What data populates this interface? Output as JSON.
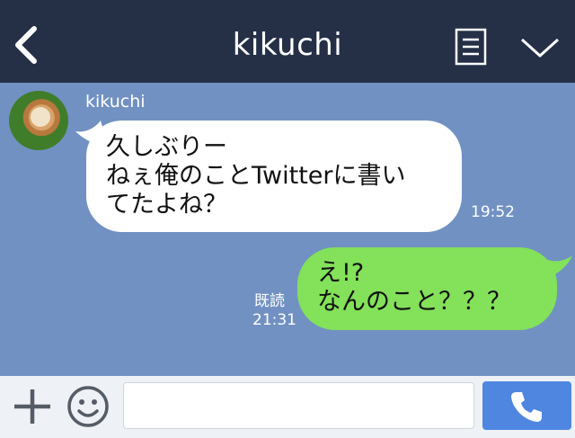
{
  "header": {
    "title": "kikuchi",
    "back_icon": "chevron-left-icon",
    "note_icon": "note-icon",
    "menu_icon": "chevron-down-icon"
  },
  "messages": [
    {
      "direction": "incoming",
      "sender": "kikuchi",
      "lines": [
        "久しぶりー",
        "ねぇ俺のことTwitterに書い",
        "てたよね？"
      ],
      "time": "19:52"
    },
    {
      "direction": "outgoing",
      "lines": [
        "え!?",
        "なんのこと？？？"
      ],
      "read_label": "既読",
      "time": "21:31"
    }
  ],
  "footer": {
    "input_value": "",
    "plus_icon": "plus-icon",
    "emoji_icon": "smiley-icon",
    "call_icon": "phone-icon"
  },
  "colors": {
    "header_bg": "#253047",
    "chat_bg": "#7191c2",
    "incoming_bubble": "#ffffff",
    "outgoing_bubble": "#83e15a",
    "footer_bg": "#eef1f5",
    "call_button": "#4f86e0"
  }
}
